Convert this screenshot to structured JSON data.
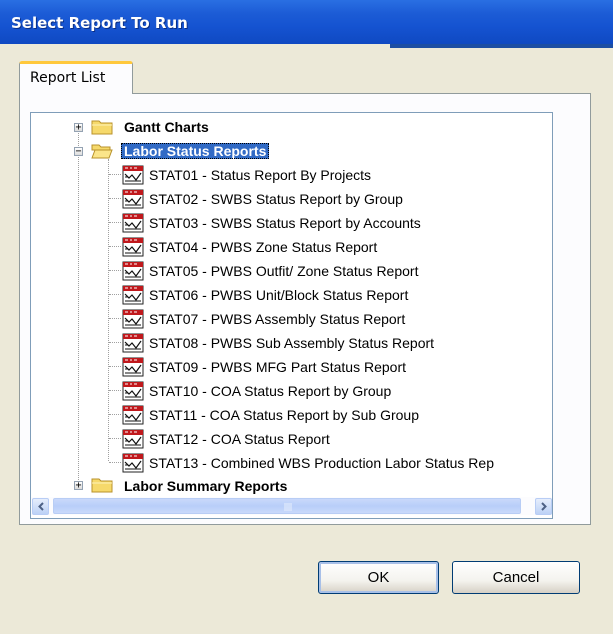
{
  "window": {
    "title": "Select Report To Run"
  },
  "tabs": [
    {
      "label": "Report List"
    }
  ],
  "tree": {
    "folders": [
      {
        "label": "Gantt Charts",
        "expanded": false
      },
      {
        "label": "Labor  Status Reports",
        "expanded": true,
        "selected": true
      },
      {
        "label": "Labor  Summary Reports",
        "expanded": false
      }
    ],
    "items": [
      {
        "label": "STAT01 - Status Report By Projects",
        "icon": "report-icon"
      },
      {
        "label": "STAT02 - SWBS Status Report by Group",
        "icon": "report-icon"
      },
      {
        "label": "STAT03 - SWBS Status Report by Accounts",
        "icon": "report-icon"
      },
      {
        "label": "STAT04 - PWBS Zone Status Report",
        "icon": "report-icon"
      },
      {
        "label": "STAT05 - PWBS Outfit/ Zone Status Report",
        "icon": "report-icon"
      },
      {
        "label": "STAT06 - PWBS Unit/Block Status Report",
        "icon": "report-icon"
      },
      {
        "label": "STAT07 - PWBS Assembly Status Report",
        "icon": "report-icon"
      },
      {
        "label": "STAT08 - PWBS Sub Assembly Status Report",
        "icon": "report-icon"
      },
      {
        "label": "STAT09 - PWBS MFG Part Status Report",
        "icon": "report-icon"
      },
      {
        "label": "STAT10 - COA Status Report by Group",
        "icon": "report-icon"
      },
      {
        "label": "STAT11 - COA Status Report by Sub Group",
        "icon": "report-icon"
      },
      {
        "label": "STAT12 - COA Status Report",
        "icon": "report-icon"
      },
      {
        "label": "STAT13 - Combined WBS Production Labor Status Rep",
        "icon": "report-icon"
      }
    ]
  },
  "scrollbars": {
    "vertical": {
      "up_icon": "chevron-up-icon",
      "down_icon": "chevron-down-icon",
      "grip_icon": "grip-icon"
    },
    "horizontal": {
      "left_icon": "chevron-left-icon",
      "right_icon": "chevron-right-icon",
      "grip_icon": "grip-icon"
    }
  },
  "buttons": {
    "ok": "OK",
    "cancel": "Cancel"
  },
  "colors": {
    "selection": "#316ac5",
    "title_bar": "#1553d1",
    "tab_accent": "#ffc83c"
  }
}
